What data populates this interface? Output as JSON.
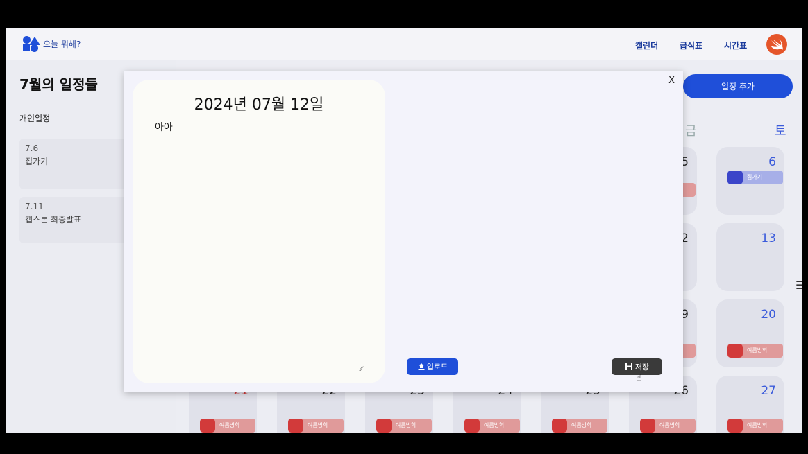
{
  "header": {
    "app_name": "오늘 뭐해?",
    "nav": [
      "캘린더",
      "급식표",
      "시간표"
    ]
  },
  "sidebar": {
    "title": "7월의 일정들",
    "tab": "개인일정",
    "events": [
      {
        "date": "7.6",
        "title": "집가기"
      },
      {
        "date": "7.11",
        "title": "캡스톤 최종발표"
      }
    ]
  },
  "calendar": {
    "add_button": "일정 추가",
    "weekdays_visible": [
      "금",
      "토"
    ],
    "visible_days": [
      "5",
      "6",
      "2",
      "13",
      "9",
      "20",
      "21",
      "22",
      "23",
      "24",
      "25",
      "26",
      "27"
    ],
    "chip_labels": {
      "blue": "집가기",
      "red": "여름방학"
    }
  },
  "modal": {
    "close_label": "X",
    "date": "2024년 07월 12일",
    "note_text": "아아",
    "upload_label": "업로드",
    "save_label": "저장"
  },
  "colors": {
    "accent": "#1f4fd9",
    "saturday": "#3b5bdb",
    "holiday_red": "#d23a3a",
    "save_dark": "#3a3a3a"
  }
}
